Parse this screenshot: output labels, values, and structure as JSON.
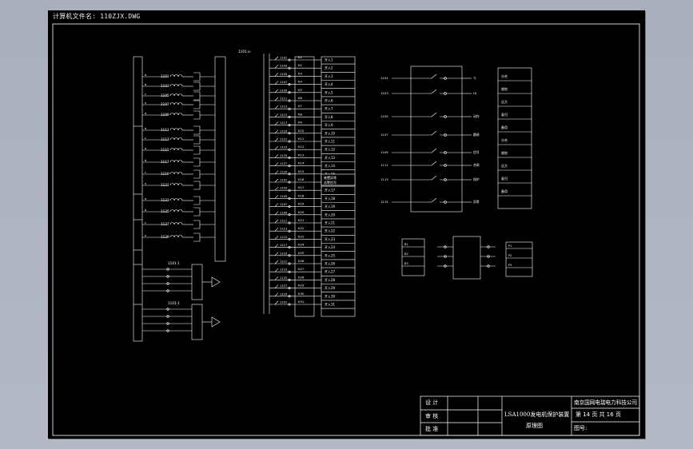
{
  "file_label": "计算机文件名: 110ZJX.DWG",
  "title_block": {
    "design": "设 计",
    "review": "审 核",
    "approve": "批 准",
    "title_line1": "LSA1000发电机保护装置",
    "title_line2": "原理图",
    "company": "南京国网电瑞电力科技公司",
    "page_of": "第  14  页  共 16  页",
    "drawing_no": "图号:"
  },
  "diagram": {
    "top_input_label": "1101 o-",
    "left_tags": [
      "1101",
      "1103",
      "1105",
      "1107",
      "1109",
      "1111",
      "1113",
      "1115",
      "1117",
      "1119",
      "1121",
      "1123",
      "1125",
      "1127",
      "1129"
    ],
    "right_panel_labels": [
      "分合",
      "就地",
      "远方",
      "复归",
      "备用"
    ],
    "mid_column_labels": [
      "开入1",
      "开入2",
      "开入3",
      "开入4",
      "开入5",
      "开入6",
      "开入7",
      "开入8",
      "开入9",
      "开入10",
      "开入11",
      "开入12",
      "开入13",
      "开入14",
      "开入15",
      "开入16",
      "开入17",
      "开入18",
      "开入19",
      "开入20",
      "开入21",
      "开入22",
      "开入23",
      "开入24",
      "开入25",
      "开入26",
      "开入27",
      "开入28",
      "开入29",
      "开入30",
      "开入31",
      "开入32"
    ],
    "long_input_label": "装置异常\n告警信号",
    "relay_legend": [
      "TJ",
      "HJ",
      "动作",
      "跳闸",
      "信号",
      "合闸",
      "保护",
      "异常",
      "告警",
      "备用",
      "远方"
    ]
  }
}
